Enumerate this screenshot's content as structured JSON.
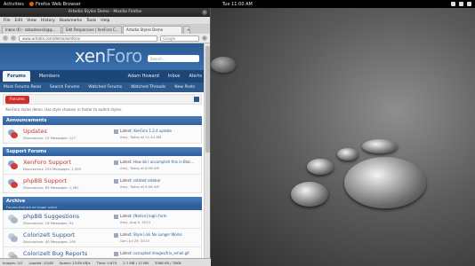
{
  "topbar": {
    "activities": "Activities",
    "app_menu": "Firefox Web Browser",
    "clock": "Tue 11:00 AM"
  },
  "window": {
    "title": "Artodia Styles Demo - Mozilla Firefox",
    "menu": [
      "File",
      "Edit",
      "View",
      "History",
      "Bookmarks",
      "Tools",
      "Help"
    ],
    "tabs": [
      "Inbox (6) - zabozkovski@g...",
      "Edit Responsive | XenForo C...",
      "Artodia Styles Demo",
      "+"
    ],
    "url": "www.artodia.com/demo/xenforo/",
    "search_placeholder": "Google"
  },
  "site": {
    "logo_part1": "xen",
    "logo_part2": "Foro",
    "search_placeholder": "Search...",
    "nav": {
      "forums": "Forums",
      "members": "Members",
      "user": "Adam Howard",
      "inbox": "Inbox",
      "alerts": "Alerts"
    },
    "subnav": [
      "Mark Forums Read",
      "Search Forums",
      "Watched Forums",
      "Watched Threads",
      "New Posts"
    ],
    "crumb": "Forums",
    "description": "XenForo styles demo. Use style chooser in footer to switch styles.",
    "categories": [
      {
        "title": "Announcements",
        "desc": "",
        "forums": [
          {
            "name": "Updates",
            "stats": "Discussions: 15 Messages: 127",
            "latest": "XenForo 1.2.4 update",
            "latest_by": "Amy, Today at 11:44 AM",
            "unread": true
          }
        ]
      },
      {
        "title": "Support Forums",
        "desc": "",
        "forums": [
          {
            "name": "XenForo Support",
            "stats": "Discussions: 225 Messages: 1,393",
            "latest": "How do I accomplish this in Blac...",
            "latest_by": "Amy, Today at 6:36 AM",
            "unread": true
          },
          {
            "name": "phpBB Support",
            "stats": "Discussions: 83 Messages: 1,367",
            "latest": "rotated sidebar",
            "latest_by": "Amy, Today at 6:08 AM",
            "unread": true
          }
        ]
      },
      {
        "title": "Archive",
        "desc": "Forums that are no longer active",
        "forums": [
          {
            "name": "phpBB Suggestions",
            "stats": "Discussions: 18 Messages: 54",
            "latest": "[Notice] login form",
            "latest_by": "Amy, Aug 5, 2013",
            "unread": false
          },
          {
            "name": "Colorizelt Support",
            "stats": "Discussions: 40 Messages: 195",
            "latest": "Style Link No Longer Works",
            "latest_by": "Gon, Jul 29, 2013",
            "unread": false
          },
          {
            "name": "Colorizelt Bug Reports",
            "stats": "",
            "latest": "corrupted images/trix_email.gif",
            "latest_by": "",
            "unread": false
          }
        ]
      }
    ]
  },
  "statusbar": [
    "Images: 2/2",
    "Loaded: 10/48",
    "Speed: 23.89 KB/s",
    "Time: 0.670",
    "2.7 MB / 12 MB",
    "3368 KB / 78KB"
  ]
}
